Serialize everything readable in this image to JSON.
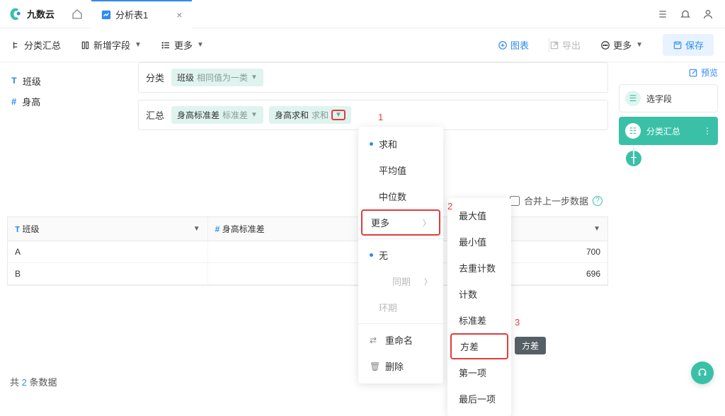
{
  "brand": "九数云",
  "tab": {
    "title": "分析表1"
  },
  "toolbar": {
    "classify": "分类汇总",
    "add_field": "新增字段",
    "more": "更多",
    "chart": "图表",
    "export": "导出",
    "more2": "更多",
    "save": "保存"
  },
  "sidebar_fields": {
    "class": "班级",
    "height": "身高"
  },
  "config": {
    "classify_label": "分类",
    "summary_label": "汇总",
    "class_pill": {
      "name": "班级",
      "sub": "相同值为一类"
    },
    "std_pill": {
      "name": "身高标准差",
      "sub": "标准差"
    },
    "sum_pill": {
      "name": "身高求和",
      "sub": "求和"
    }
  },
  "merge": {
    "label": "合并上一步数据"
  },
  "menu1": {
    "sum": "求和",
    "avg": "平均值",
    "median": "中位数",
    "more": "更多",
    "none": "无",
    "yoy": "同期",
    "mom": "环期",
    "rename": "重命名",
    "delete": "删除"
  },
  "menu2": {
    "max": "最大值",
    "min": "最小值",
    "distinct": "去重计数",
    "count": "计数",
    "stddev": "标准差",
    "variance": "方差",
    "first": "第一项",
    "last": "最后一项"
  },
  "tooltip": "方差",
  "anno": {
    "a1": "1",
    "a2": "2",
    "a3": "3"
  },
  "table": {
    "cols": {
      "class": "班级",
      "std": "身高标准差"
    },
    "rows": [
      {
        "class": "A",
        "val": "700"
      },
      {
        "class": "B",
        "val": "696"
      }
    ]
  },
  "right": {
    "preview": "预览",
    "select_field": "选字段",
    "classify": "分类汇总"
  },
  "footer": {
    "prefix": "共",
    "count": "2",
    "suffix": "条数据"
  }
}
